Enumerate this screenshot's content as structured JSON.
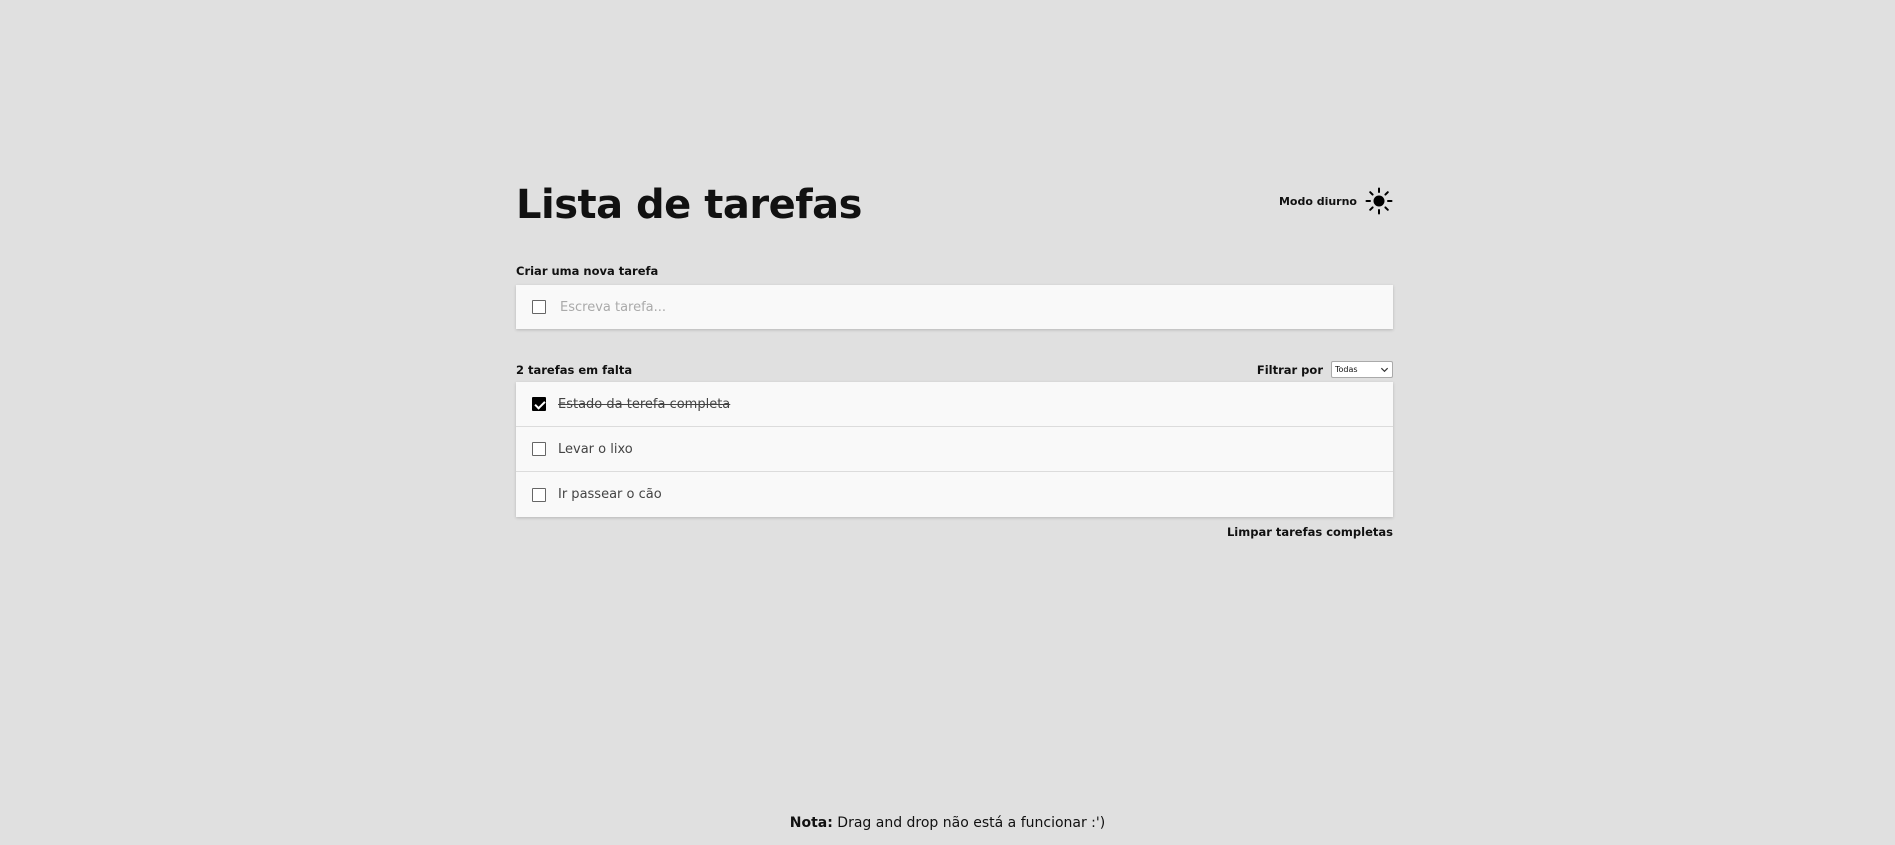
{
  "header": {
    "title": "Lista de tarefas",
    "theme_label": "Modo diurno",
    "theme_icon": "sun-icon"
  },
  "new_task": {
    "section_label": "Criar uma nova tarefa",
    "placeholder": "Escreva tarefa...",
    "value": ""
  },
  "list": {
    "remaining_label": "2 tarefas em falta",
    "filter_label": "Filtrar por",
    "filter_selected": "Todas",
    "items": [
      {
        "label": "Estado da terefa completa",
        "completed": true
      },
      {
        "label": "Levar o lixo",
        "completed": false
      },
      {
        "label": "Ir passear o cão",
        "completed": false
      }
    ],
    "clear_completed_label": "Limpar tarefas completas"
  },
  "footer": {
    "note_label": "Nota:",
    "note_text": " Drag and drop não está a funcionar :')"
  },
  "colors": {
    "background": "#e0e0e0",
    "card": "#f9f9f9",
    "text": "#111111"
  }
}
